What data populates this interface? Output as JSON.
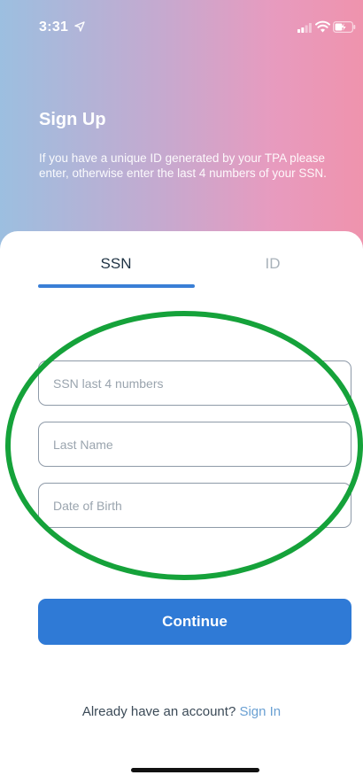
{
  "status_bar": {
    "time": "3:31",
    "icons": [
      "location-arrow-icon",
      "cellular-signal-icon",
      "wifi-icon",
      "battery-charging-icon"
    ]
  },
  "header": {
    "title": "Sign Up",
    "subtitle": "If you have a unique ID generated by your TPA please enter, otherwise enter the last 4 numbers of your SSN."
  },
  "tabs": [
    {
      "label": "SSN",
      "active": true
    },
    {
      "label": "ID",
      "active": false
    }
  ],
  "form": {
    "ssn_placeholder": "SSN last 4 numbers",
    "last_name_placeholder": "Last Name",
    "dob_placeholder": "Date of Birth"
  },
  "continue_label": "Continue",
  "footer": {
    "prompt": "Already have an account?",
    "signin_label": "Sign In"
  },
  "colors": {
    "gradient_left": "#9cbfe0",
    "gradient_right": "#ef93ad",
    "accent": "#2f7ad6",
    "link": "#6aa0d3",
    "annotation_ellipse": "#15a23a"
  }
}
